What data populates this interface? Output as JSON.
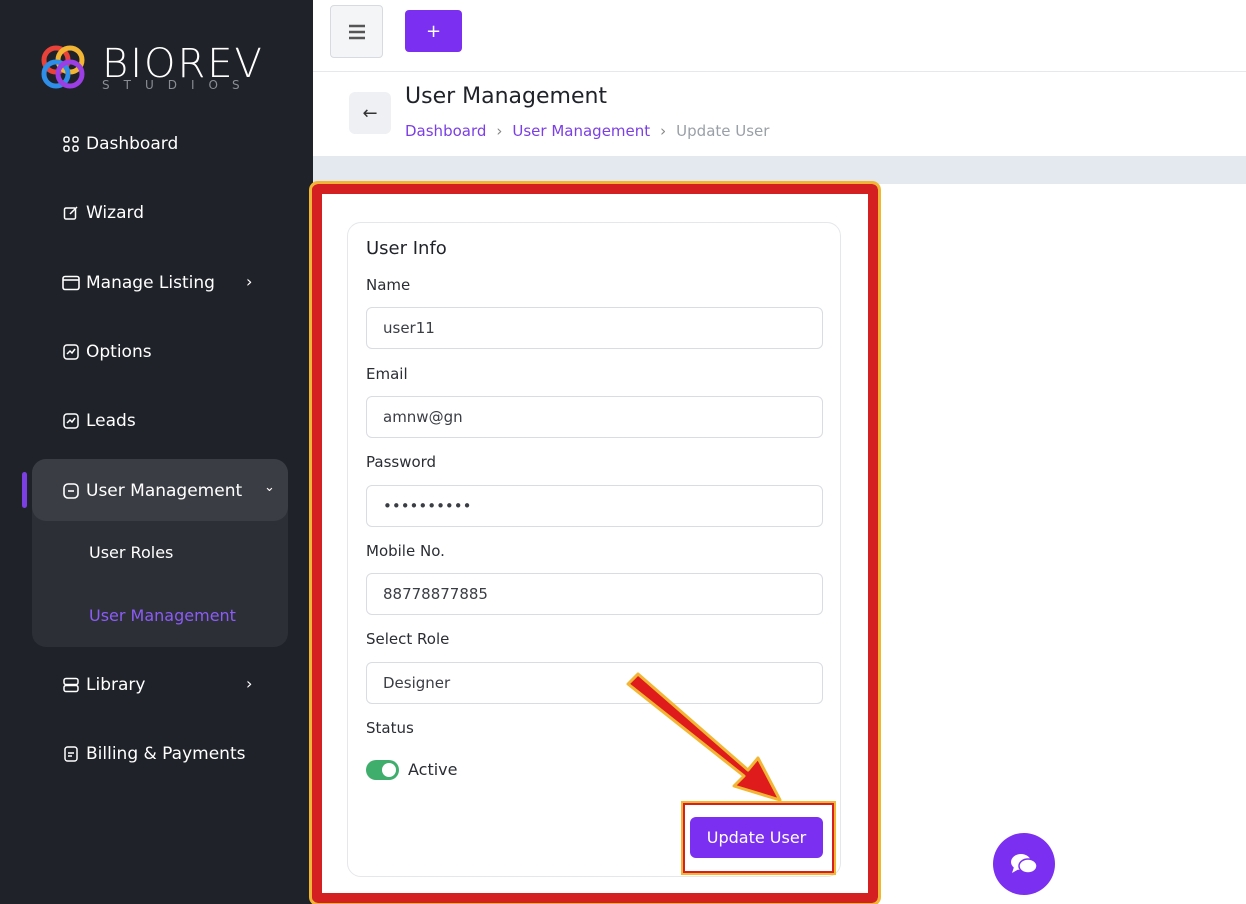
{
  "sidebar": {
    "logo": {
      "name": "BIOREV",
      "sub": "STUDIOS"
    },
    "items": [
      {
        "label": "Dashboard",
        "icon": "grid-icon"
      },
      {
        "label": "Wizard",
        "icon": "edit-icon"
      },
      {
        "label": "Manage Listing",
        "icon": "folder-icon"
      },
      {
        "label": "Options",
        "icon": "chart-icon"
      },
      {
        "label": "Leads",
        "icon": "chart-icon"
      },
      {
        "label": "User Management",
        "icon": "user-box-icon"
      },
      {
        "label": "Library",
        "icon": "server-icon"
      },
      {
        "label": "Billing & Payments",
        "icon": "receipt-icon"
      }
    ],
    "sub_items": [
      {
        "label": "User Roles"
      },
      {
        "label": "User Management"
      }
    ],
    "accent_color": "#7b3fe4"
  },
  "topbar": {
    "plus_label": "+"
  },
  "header": {
    "title": "User Management",
    "breadcrumb": [
      "Dashboard",
      "User Management",
      "Update User"
    ]
  },
  "form": {
    "title": "User Info",
    "name_label": "Name",
    "name_value": "user11",
    "email_label": "Email",
    "email_value": "amnw@gn",
    "password_label": "Password",
    "password_value": "••••••••••",
    "mobile_label": "Mobile No.",
    "mobile_value": "88778877885",
    "role_label": "Select Role",
    "role_value": "Designer",
    "status_label": "Status",
    "status_value": "Active",
    "submit_label": "Update User"
  }
}
